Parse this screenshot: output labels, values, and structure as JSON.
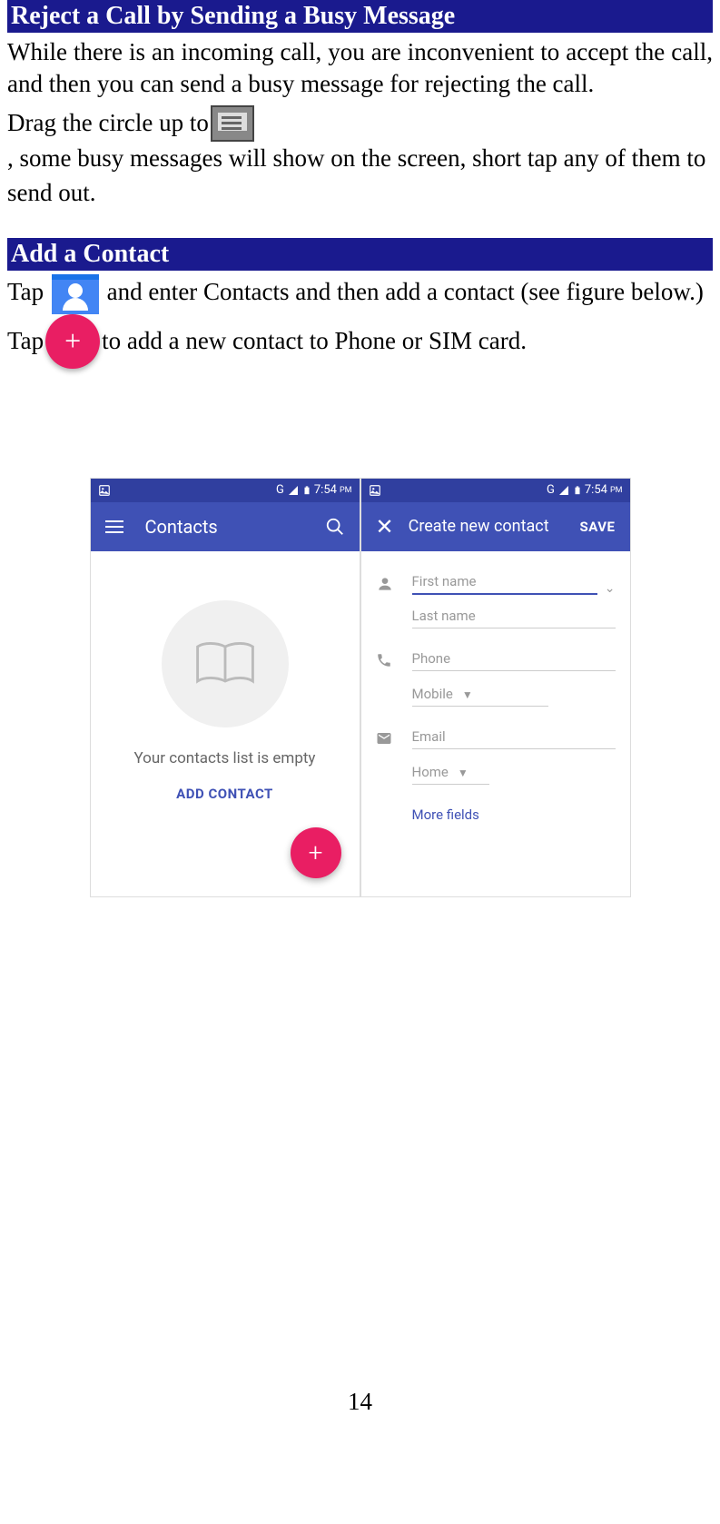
{
  "section1": {
    "title": "Reject a Call by Sending a Busy Message",
    "para1": "While there is an incoming call, you are inconvenient to accept the call, and then you can send a busy message for rejecting the call.",
    "para2_before": "Drag the circle up to",
    "para2_after": ", some busy messages will show on the screen, short tap any of them to send out."
  },
  "section2": {
    "title": "Add a Contact",
    "para1_before": "Tap",
    "para1_after": "and enter Contacts and then add a contact (see figure below.)",
    "para2_before": "Tap",
    "para2_after": "to add a new contact to Phone or SIM card."
  },
  "screenshot1": {
    "status_time": "7:54",
    "status_pm": "PM",
    "status_network": "G",
    "app_title": "Contacts",
    "empty_text": "Your contacts list is empty",
    "add_link": "ADD CONTACT",
    "fab_label": "+"
  },
  "screenshot2": {
    "status_time": "7:54",
    "status_pm": "PM",
    "status_network": "G",
    "app_title": "Create new contact",
    "save_btn": "SAVE",
    "first_name": "First name",
    "last_name": "Last name",
    "phone": "Phone",
    "mobile": "Mobile",
    "email": "Email",
    "home": "Home",
    "more_fields": "More fields"
  },
  "page_number": "14"
}
